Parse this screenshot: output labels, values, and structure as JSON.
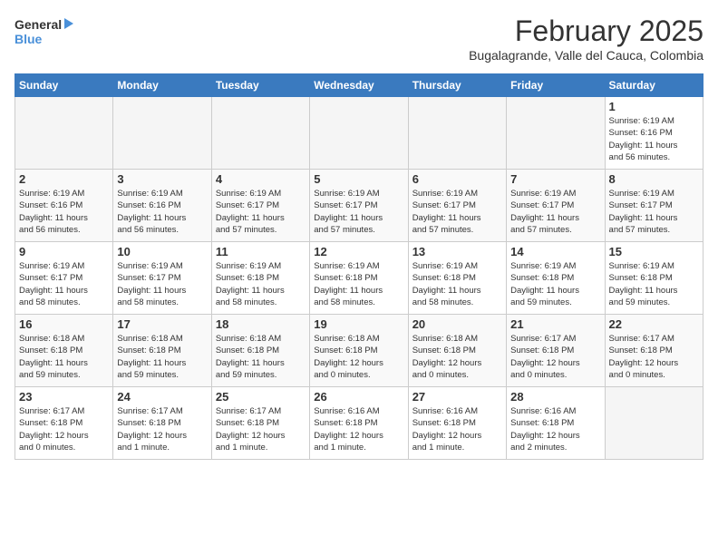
{
  "logo": {
    "line1": "General",
    "line2": "Blue"
  },
  "title": "February 2025",
  "subtitle": "Bugalagrande, Valle del Cauca, Colombia",
  "days_of_week": [
    "Sunday",
    "Monday",
    "Tuesday",
    "Wednesday",
    "Thursday",
    "Friday",
    "Saturday"
  ],
  "weeks": [
    [
      {
        "day": "",
        "info": ""
      },
      {
        "day": "",
        "info": ""
      },
      {
        "day": "",
        "info": ""
      },
      {
        "day": "",
        "info": ""
      },
      {
        "day": "",
        "info": ""
      },
      {
        "day": "",
        "info": ""
      },
      {
        "day": "1",
        "info": "Sunrise: 6:19 AM\nSunset: 6:16 PM\nDaylight: 11 hours\nand 56 minutes."
      }
    ],
    [
      {
        "day": "2",
        "info": "Sunrise: 6:19 AM\nSunset: 6:16 PM\nDaylight: 11 hours\nand 56 minutes."
      },
      {
        "day": "3",
        "info": "Sunrise: 6:19 AM\nSunset: 6:16 PM\nDaylight: 11 hours\nand 56 minutes."
      },
      {
        "day": "4",
        "info": "Sunrise: 6:19 AM\nSunset: 6:17 PM\nDaylight: 11 hours\nand 57 minutes."
      },
      {
        "day": "5",
        "info": "Sunrise: 6:19 AM\nSunset: 6:17 PM\nDaylight: 11 hours\nand 57 minutes."
      },
      {
        "day": "6",
        "info": "Sunrise: 6:19 AM\nSunset: 6:17 PM\nDaylight: 11 hours\nand 57 minutes."
      },
      {
        "day": "7",
        "info": "Sunrise: 6:19 AM\nSunset: 6:17 PM\nDaylight: 11 hours\nand 57 minutes."
      },
      {
        "day": "8",
        "info": "Sunrise: 6:19 AM\nSunset: 6:17 PM\nDaylight: 11 hours\nand 57 minutes."
      }
    ],
    [
      {
        "day": "9",
        "info": "Sunrise: 6:19 AM\nSunset: 6:17 PM\nDaylight: 11 hours\nand 58 minutes."
      },
      {
        "day": "10",
        "info": "Sunrise: 6:19 AM\nSunset: 6:17 PM\nDaylight: 11 hours\nand 58 minutes."
      },
      {
        "day": "11",
        "info": "Sunrise: 6:19 AM\nSunset: 6:18 PM\nDaylight: 11 hours\nand 58 minutes."
      },
      {
        "day": "12",
        "info": "Sunrise: 6:19 AM\nSunset: 6:18 PM\nDaylight: 11 hours\nand 58 minutes."
      },
      {
        "day": "13",
        "info": "Sunrise: 6:19 AM\nSunset: 6:18 PM\nDaylight: 11 hours\nand 58 minutes."
      },
      {
        "day": "14",
        "info": "Sunrise: 6:19 AM\nSunset: 6:18 PM\nDaylight: 11 hours\nand 59 minutes."
      },
      {
        "day": "15",
        "info": "Sunrise: 6:19 AM\nSunset: 6:18 PM\nDaylight: 11 hours\nand 59 minutes."
      }
    ],
    [
      {
        "day": "16",
        "info": "Sunrise: 6:18 AM\nSunset: 6:18 PM\nDaylight: 11 hours\nand 59 minutes."
      },
      {
        "day": "17",
        "info": "Sunrise: 6:18 AM\nSunset: 6:18 PM\nDaylight: 11 hours\nand 59 minutes."
      },
      {
        "day": "18",
        "info": "Sunrise: 6:18 AM\nSunset: 6:18 PM\nDaylight: 11 hours\nand 59 minutes."
      },
      {
        "day": "19",
        "info": "Sunrise: 6:18 AM\nSunset: 6:18 PM\nDaylight: 12 hours\nand 0 minutes."
      },
      {
        "day": "20",
        "info": "Sunrise: 6:18 AM\nSunset: 6:18 PM\nDaylight: 12 hours\nand 0 minutes."
      },
      {
        "day": "21",
        "info": "Sunrise: 6:17 AM\nSunset: 6:18 PM\nDaylight: 12 hours\nand 0 minutes."
      },
      {
        "day": "22",
        "info": "Sunrise: 6:17 AM\nSunset: 6:18 PM\nDaylight: 12 hours\nand 0 minutes."
      }
    ],
    [
      {
        "day": "23",
        "info": "Sunrise: 6:17 AM\nSunset: 6:18 PM\nDaylight: 12 hours\nand 0 minutes."
      },
      {
        "day": "24",
        "info": "Sunrise: 6:17 AM\nSunset: 6:18 PM\nDaylight: 12 hours\nand 1 minute."
      },
      {
        "day": "25",
        "info": "Sunrise: 6:17 AM\nSunset: 6:18 PM\nDaylight: 12 hours\nand 1 minute."
      },
      {
        "day": "26",
        "info": "Sunrise: 6:16 AM\nSunset: 6:18 PM\nDaylight: 12 hours\nand 1 minute."
      },
      {
        "day": "27",
        "info": "Sunrise: 6:16 AM\nSunset: 6:18 PM\nDaylight: 12 hours\nand 1 minute."
      },
      {
        "day": "28",
        "info": "Sunrise: 6:16 AM\nSunset: 6:18 PM\nDaylight: 12 hours\nand 2 minutes."
      },
      {
        "day": "",
        "info": ""
      }
    ]
  ]
}
